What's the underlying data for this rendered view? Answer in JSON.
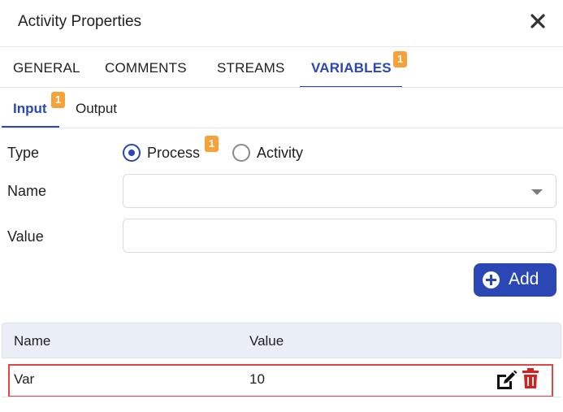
{
  "window": {
    "title": "Activity Properties"
  },
  "tabs": [
    {
      "label": "GENERAL"
    },
    {
      "label": "COMMENTS"
    },
    {
      "label": "STREAMS"
    },
    {
      "label": "VARIABLES",
      "badge": "1",
      "active": true
    }
  ],
  "subtabs": [
    {
      "label": "Input",
      "badge": "1",
      "active": true
    },
    {
      "label": "Output"
    }
  ],
  "form": {
    "type_label": "Type",
    "type_options": [
      {
        "label": "Process",
        "selected": true,
        "badge": "1"
      },
      {
        "label": "Activity",
        "selected": false
      }
    ],
    "name_label": "Name",
    "name_value": "",
    "value_label": "Value",
    "value_value": "",
    "add_label": "Add"
  },
  "table": {
    "columns": [
      "Name",
      "Value"
    ],
    "rows": [
      {
        "name": "Var",
        "value": "10"
      }
    ]
  },
  "colors": {
    "accent": "#2b47b5",
    "badge": "#f7a239",
    "delete": "#d61f1f",
    "highlight": "#e04646"
  },
  "icons": {
    "close": "close-icon",
    "dropdown": "chevron-down-icon",
    "add": "plus-circle-icon",
    "edit": "edit-icon",
    "delete": "trash-icon"
  }
}
